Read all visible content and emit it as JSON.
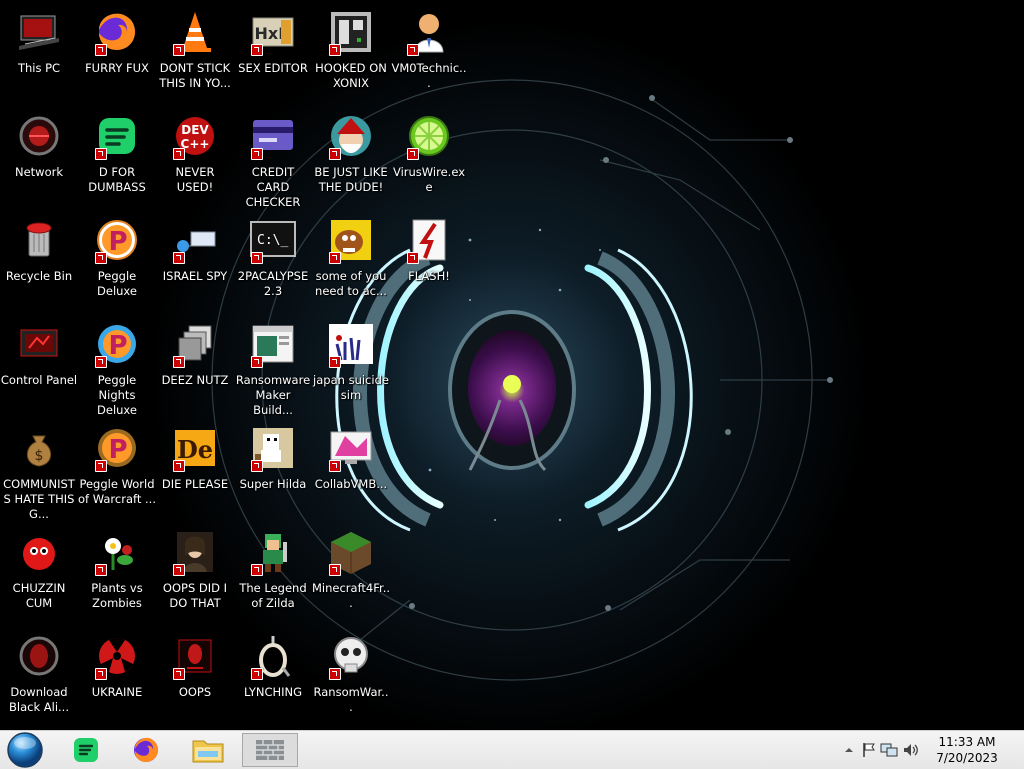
{
  "desktop": {
    "icons": [
      {
        "label": "This PC",
        "icon": "computer-icon"
      },
      {
        "label": "Network",
        "icon": "network-icon"
      },
      {
        "label": "Recycle Bin",
        "icon": "recycle-bin-icon"
      },
      {
        "label": "Control Panel",
        "icon": "control-panel-icon"
      },
      {
        "label": "COMMUNISTS HATE THIS G...",
        "icon": "money-bag-icon"
      },
      {
        "label": "CHUZZIN CUM",
        "icon": "chuzzle-icon"
      },
      {
        "label": "Download Black Ali...",
        "icon": "alien-icon"
      },
      {
        "label": "FURRY FUX",
        "icon": "firefox-icon"
      },
      {
        "label": "D FOR DUMBASS",
        "icon": "spotify-like-icon"
      },
      {
        "label": "Peggle Deluxe",
        "icon": "peggle-icon"
      },
      {
        "label": "Peggle Nights Deluxe",
        "icon": "peggle-nights-icon"
      },
      {
        "label": "Peggle World of Warcraft ...",
        "icon": "peggle-wow-icon"
      },
      {
        "label": "Plants vs Zombies",
        "icon": "flower-icon"
      },
      {
        "label": "UKRAINE",
        "icon": "radiation-icon"
      },
      {
        "label": "DONT STICK THIS IN YO...",
        "icon": "traffic-cone-icon"
      },
      {
        "label": "NEVER USED!",
        "icon": "dev-cpp-icon"
      },
      {
        "label": "ISRAEL SPY",
        "icon": "network-device-icon"
      },
      {
        "label": "DEEZ NUTZ",
        "icon": "windows-stack-icon"
      },
      {
        "label": "DIE PLEASE",
        "icon": "de-logo-icon"
      },
      {
        "label": "OOPS DID I DO THAT",
        "icon": "portrait-icon"
      },
      {
        "label": "OOPS",
        "icon": "alien-red-icon"
      },
      {
        "label": "SEX EDITOR",
        "icon": "hxd-icon"
      },
      {
        "label": "CREDIT CARD CHECKER",
        "icon": "credit-card-icon"
      },
      {
        "label": "2PACALYPSE 2.3",
        "icon": "terminal-icon"
      },
      {
        "label": "Ransomware Maker Build...",
        "icon": "window-app-icon"
      },
      {
        "label": "Super Hilda",
        "icon": "pixel-dog-icon"
      },
      {
        "label": "The Legend of Zilda",
        "icon": "pixel-hero-icon"
      },
      {
        "label": "LYNCHING",
        "icon": "noose-icon"
      },
      {
        "label": "HOOKED ON XONIX",
        "icon": "xonix-icon"
      },
      {
        "label": "BE JUST LIKE THE DUDE!",
        "icon": "santa-icon"
      },
      {
        "label": "some of you need to ac...",
        "icon": "dog-icon"
      },
      {
        "label": "japan suicide sim",
        "icon": "japanese-icon"
      },
      {
        "label": "CollabVMB...",
        "icon": "monitor-icon"
      },
      {
        "label": "Minecraft4Fr...",
        "icon": "grass-block-icon"
      },
      {
        "label": "RansomWar...",
        "icon": "skull-icon"
      },
      {
        "label": "VM0Technic...",
        "icon": "doctor-icon"
      },
      {
        "label": "VirusWire.exe",
        "icon": "lime-icon"
      },
      {
        "label": "FLASH!",
        "icon": "flash-icon"
      }
    ]
  },
  "taskbar": {
    "start": "start-orb-icon",
    "pinned": [
      {
        "name": "spotify-like-icon"
      },
      {
        "name": "firefox-icon"
      },
      {
        "name": "file-explorer-icon"
      },
      {
        "name": "brick-wall-icon"
      }
    ],
    "tray": {
      "icons": [
        "chevron-up-icon",
        "flag-icon",
        "network-icon",
        "volume-icon"
      ],
      "time": "11:33 AM",
      "date": "7/20/2023"
    }
  },
  "colors": {
    "taskbar_bg": "#ececec",
    "label_text": "#ffffff",
    "wallpaper_glow": "#5ad8ff",
    "shortcut_arrow": "#cc0000"
  }
}
